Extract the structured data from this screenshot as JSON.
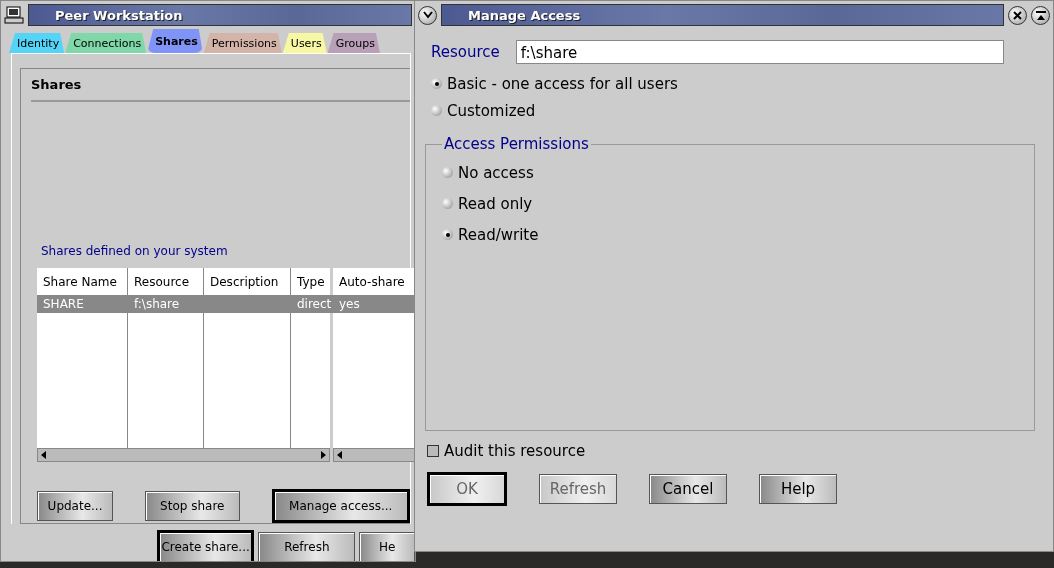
{
  "main_window": {
    "title": "Peer Workstation",
    "tabs": [
      {
        "label": "Identity",
        "selected": false,
        "color": "#55d4f8"
      },
      {
        "label": "Connections",
        "selected": false,
        "color": "#80d8a8"
      },
      {
        "label": "Shares",
        "selected": true,
        "color": "#8094f8"
      },
      {
        "label": "Permissions",
        "selected": false,
        "color": "#d4b4a8"
      },
      {
        "label": "Users",
        "selected": false,
        "color": "#f8f8a4"
      },
      {
        "label": "Groups",
        "selected": false,
        "color": "#b8a0b8"
      }
    ],
    "page_title": "Shares",
    "list_caption": "Shares defined on your system",
    "table": {
      "columns": [
        "Share Name",
        "Resource",
        "Description",
        "Type",
        "Auto-share"
      ],
      "rows": [
        {
          "cells": [
            "SHARE",
            "f:\\share",
            "",
            "direct",
            "yes"
          ],
          "selected": true
        }
      ]
    },
    "buttons": [
      {
        "label": "Update...",
        "default": false
      },
      {
        "label": "Stop share",
        "default": false
      },
      {
        "label": "Manage access...",
        "default": true
      }
    ],
    "footer_buttons": [
      {
        "label": "Create share...",
        "default": true
      },
      {
        "label": "Refresh",
        "default": false
      },
      {
        "label": "He",
        "default": false
      }
    ]
  },
  "dialog": {
    "title": "Manage Access",
    "resource_label": "Resource",
    "resource_value": "f:\\share",
    "modes": [
      {
        "label": "Basic - one access for all users",
        "selected": true
      },
      {
        "label": "Customized",
        "selected": false
      }
    ],
    "permissions_title": "Access Permissions",
    "permissions": [
      {
        "label": "No access",
        "selected": false
      },
      {
        "label": "Read only",
        "selected": false
      },
      {
        "label": "Read/write",
        "selected": true
      }
    ],
    "audit": {
      "label": "Audit this resource",
      "checked": false
    },
    "buttons": [
      {
        "label": "OK",
        "disabled": true,
        "default": true
      },
      {
        "label": "Refresh",
        "disabled": true,
        "default": false
      },
      {
        "label": "Cancel",
        "disabled": false,
        "default": false
      },
      {
        "label": "Help",
        "disabled": false,
        "default": false
      }
    ]
  }
}
